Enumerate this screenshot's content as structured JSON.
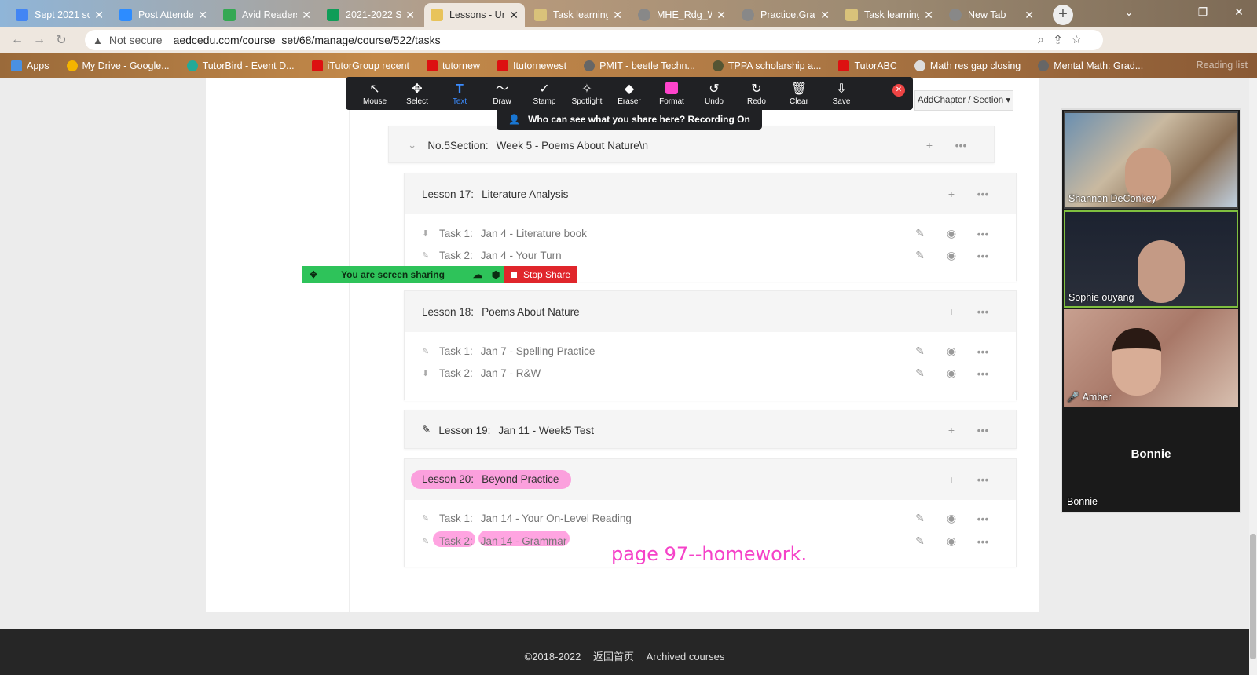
{
  "browser": {
    "tabs": [
      {
        "title": "Sept 2021 sc",
        "color": "#4285f4"
      },
      {
        "title": "Post Attende",
        "color": "#2d8cff"
      },
      {
        "title": "Avid Readers",
        "color": "#34a853"
      },
      {
        "title": "2021-2022 S",
        "color": "#0f9d58"
      },
      {
        "title": "Lessons - Ur",
        "color": "#e8c35a"
      },
      {
        "title": "Task learning",
        "color": "#d9c27a"
      },
      {
        "title": "MHE_Rdg_W",
        "color": "#888888"
      },
      {
        "title": "Practice.Gran",
        "color": "#888888"
      },
      {
        "title": "Task learning",
        "color": "#d9c27a"
      },
      {
        "title": "New Tab",
        "color": "#888888"
      }
    ],
    "security": "Not secure",
    "url": "aedcedu.com/course_set/68/manage/course/522/tasks",
    "bookmarks": [
      "Apps",
      "My Drive - Google...",
      "TutorBird - Event D...",
      "iTutorGroup recent",
      "tutornew",
      "Itutornewest",
      "PMIT - beetle Techn...",
      "TPPA scholarship a...",
      "TutorABC",
      "Math res gap closing",
      "Mental Math: Grad..."
    ],
    "reading_list": "Reading list"
  },
  "zoom_toolbar": {
    "tools": [
      {
        "label": "Mouse",
        "icon": "↖"
      },
      {
        "label": "Select",
        "icon": "✥"
      },
      {
        "label": "Text",
        "icon": "T"
      },
      {
        "label": "Draw",
        "icon": "〜"
      },
      {
        "label": "Stamp",
        "icon": "✓"
      },
      {
        "label": "Spotlight",
        "icon": "✧"
      },
      {
        "label": "Eraser",
        "icon": "◆"
      },
      {
        "label": "Format",
        "icon": ""
      },
      {
        "label": "Undo",
        "icon": "↺"
      },
      {
        "label": "Redo",
        "icon": "↻"
      },
      {
        "label": "Clear",
        "icon": "🗑"
      },
      {
        "label": "Save",
        "icon": "⇩"
      }
    ],
    "active_tool": "Text",
    "who_can_see": "Who can see what you share here? Recording On"
  },
  "add_chapter": "AddChapter / Section",
  "screen_share": {
    "status": "You are screen sharing",
    "stop": "Stop Share"
  },
  "course": {
    "section": {
      "label": "No.5Section:",
      "title": "Week 5 - Poems About Nature\\n"
    },
    "lessons": [
      {
        "label": "Lesson 17:",
        "title": "Literature Analysis",
        "tasks": [
          {
            "label": "Task 1:",
            "title": "Jan 4 - Literature book",
            "icon": "⬇"
          },
          {
            "label": "Task 2:",
            "title": "Jan 4 - Your Turn",
            "icon": "✎"
          }
        ]
      },
      {
        "label": "Lesson 18:",
        "title": "Poems About Nature",
        "tasks": [
          {
            "label": "Task 1:",
            "title": "Jan 7 - Spelling Practice",
            "icon": "✎"
          },
          {
            "label": "Task 2:",
            "title": "Jan 7 - R&W",
            "icon": "⬇"
          }
        ]
      },
      {
        "label": "Lesson 19:",
        "title": "Jan 11 - Week5 Test"
      },
      {
        "label": "Lesson 20:",
        "title": "Beyond Practice",
        "tasks": [
          {
            "label": "Task 1:",
            "title": "Jan 14 - Your On-Level Reading",
            "icon": "✎"
          },
          {
            "label": "Task 2:",
            "title": "Jan 14 - Grammar",
            "icon": "✎"
          }
        ]
      }
    ]
  },
  "annotation": "page 97--homework.",
  "footer": {
    "copyright": "©2018-2022",
    "home": "返回首页",
    "archived": "Archived courses"
  },
  "participants": [
    {
      "name": "Shannon DeConkey"
    },
    {
      "name": "Sophie ouyang"
    },
    {
      "name": "Amber"
    },
    {
      "name": "Bonnie"
    }
  ],
  "colors": {
    "highlight": "#ff5ac8",
    "share_green": "#2ec35a",
    "stop_red": "#e0262b"
  }
}
